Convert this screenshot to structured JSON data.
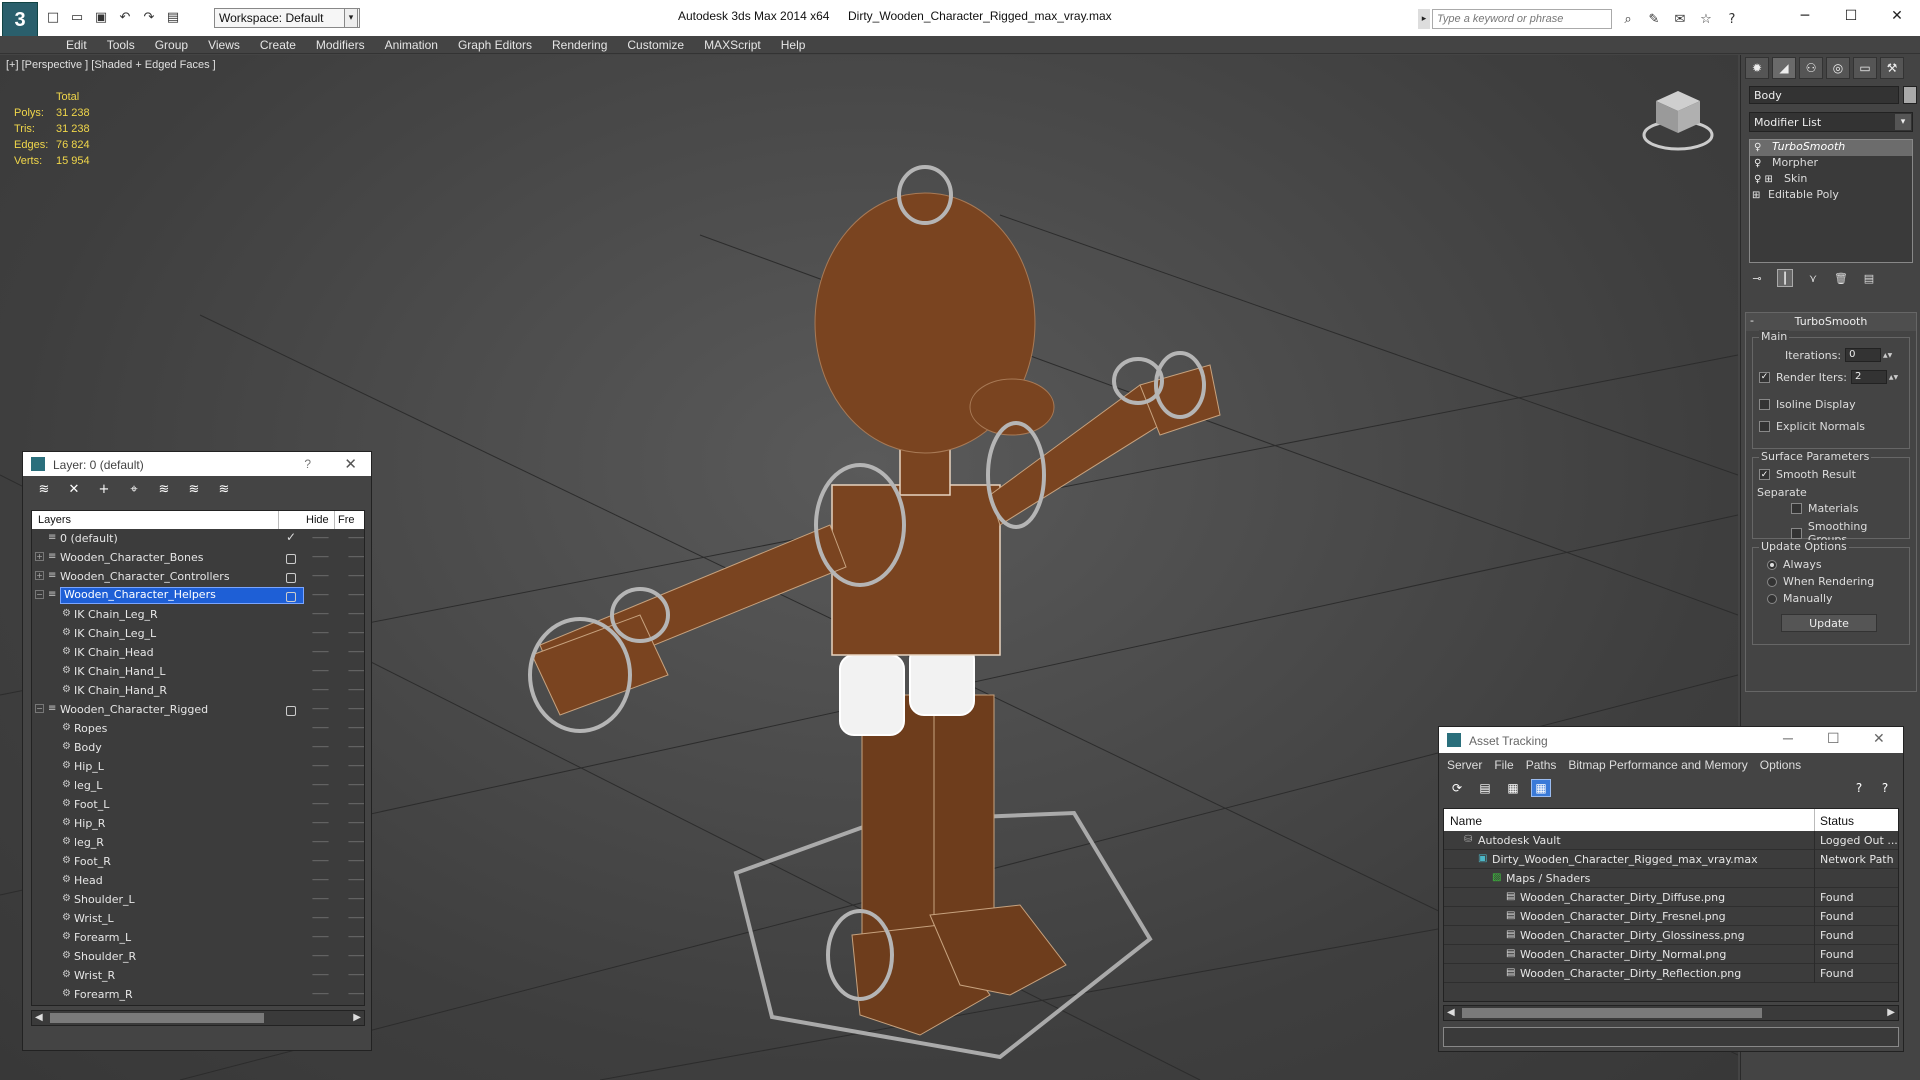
{
  "titlebar": {
    "workspace": "Workspace: Default",
    "app_title": "Autodesk 3ds Max  2014 x64",
    "file_title": "Dirty_Wooden_Character_Rigged_max_vray.max",
    "search_placeholder": "Type a keyword or phrase"
  },
  "menu": [
    "Edit",
    "Tools",
    "Group",
    "Views",
    "Create",
    "Modifiers",
    "Animation",
    "Graph Editors",
    "Rendering",
    "Customize",
    "MAXScript",
    "Help"
  ],
  "viewport": {
    "label": "[+] [Perspective ] [Shaded + Edged Faces ]",
    "stats_header": "Total",
    "stats": [
      {
        "label": "Polys:",
        "value": "31 238"
      },
      {
        "label": "Tris:",
        "value": "31 238"
      },
      {
        "label": "Edges:",
        "value": "76 824"
      },
      {
        "label": "Verts:",
        "value": "15 954"
      }
    ]
  },
  "cmdpanel": {
    "object_name": "Body",
    "modifier_list": "Modifier List",
    "stack": [
      "TurboSmooth",
      "Morpher",
      "Skin",
      "Editable Poly"
    ],
    "rollout_title": "TurboSmooth",
    "main_group": "Main",
    "iterations_label": "Iterations:",
    "iterations_value": "0",
    "render_iters_label": "Render Iters:",
    "render_iters_value": "2",
    "isoline": "Isoline Display",
    "explicit_normals": "Explicit Normals",
    "surface_group": "Surface Parameters",
    "smooth_result": "Smooth Result",
    "separate": "Separate",
    "materials": "Materials",
    "smoothing_groups": "Smoothing Groups",
    "update_group": "Update Options",
    "always": "Always",
    "when_rendering": "When Rendering",
    "manually": "Manually",
    "update_button": "Update"
  },
  "layerwin": {
    "title": "Layer: 0 (default)",
    "help": "?",
    "col_layers": "Layers",
    "col_hide": "Hide",
    "col_freeze": "Fre",
    "rows": [
      {
        "name": "0 (default)",
        "level": 0,
        "type": "layer",
        "active": true
      },
      {
        "name": "Wooden_Character_Bones",
        "level": 0,
        "type": "layer-exp"
      },
      {
        "name": "Wooden_Character_Controllers",
        "level": 0,
        "type": "layer-exp"
      },
      {
        "name": "Wooden_Character_Helpers",
        "level": 0,
        "type": "layer-open",
        "selected": true
      },
      {
        "name": "IK Chain_Leg_R",
        "level": 1,
        "type": "obj"
      },
      {
        "name": "IK Chain_Leg_L",
        "level": 1,
        "type": "obj"
      },
      {
        "name": "IK Chain_Head",
        "level": 1,
        "type": "obj"
      },
      {
        "name": "IK Chain_Hand_L",
        "level": 1,
        "type": "obj"
      },
      {
        "name": "IK Chain_Hand_R",
        "level": 1,
        "type": "obj"
      },
      {
        "name": "Wooden_Character_Rigged",
        "level": 0,
        "type": "layer-open"
      },
      {
        "name": "Ropes",
        "level": 1,
        "type": "obj"
      },
      {
        "name": "Body",
        "level": 1,
        "type": "obj"
      },
      {
        "name": "Hip_L",
        "level": 1,
        "type": "obj"
      },
      {
        "name": "leg_L",
        "level": 1,
        "type": "obj"
      },
      {
        "name": "Foot_L",
        "level": 1,
        "type": "obj"
      },
      {
        "name": "Hip_R",
        "level": 1,
        "type": "obj"
      },
      {
        "name": "leg_R",
        "level": 1,
        "type": "obj"
      },
      {
        "name": "Foot_R",
        "level": 1,
        "type": "obj"
      },
      {
        "name": "Head",
        "level": 1,
        "type": "obj"
      },
      {
        "name": "Shoulder_L",
        "level": 1,
        "type": "obj"
      },
      {
        "name": "Wrist_L",
        "level": 1,
        "type": "obj"
      },
      {
        "name": "Forearm_L",
        "level": 1,
        "type": "obj"
      },
      {
        "name": "Shoulder_R",
        "level": 1,
        "type": "obj"
      },
      {
        "name": "Wrist_R",
        "level": 1,
        "type": "obj"
      },
      {
        "name": "Forearm_R",
        "level": 1,
        "type": "obj"
      }
    ]
  },
  "assetwin": {
    "title": "Asset Tracking",
    "menu": [
      "Server",
      "File",
      "Paths",
      "Bitmap Performance and Memory",
      "Options"
    ],
    "col_name": "Name",
    "col_status": "Status",
    "rows": [
      {
        "name": "Autodesk Vault",
        "status": "Logged Out ...",
        "level": 0,
        "icon": "vault"
      },
      {
        "name": "Dirty_Wooden_Character_Rigged_max_vray.max",
        "status": "Network Path",
        "level": 1,
        "icon": "max"
      },
      {
        "name": "Maps / Shaders",
        "status": "",
        "level": 2,
        "icon": "maps"
      },
      {
        "name": "Wooden_Character_Dirty_Diffuse.png",
        "status": "Found",
        "level": 3,
        "icon": "file"
      },
      {
        "name": "Wooden_Character_Dirty_Fresnel.png",
        "status": "Found",
        "level": 3,
        "icon": "file"
      },
      {
        "name": "Wooden_Character_Dirty_Glossiness.png",
        "status": "Found",
        "level": 3,
        "icon": "file"
      },
      {
        "name": "Wooden_Character_Dirty_Normal.png",
        "status": "Found",
        "level": 3,
        "icon": "file"
      },
      {
        "name": "Wooden_Character_Dirty_Reflection.png",
        "status": "Found",
        "level": 3,
        "icon": "file"
      }
    ]
  },
  "colors": {
    "stats_yellow": "#f0d64a",
    "selection_blue": "#1e5fd6",
    "wood": "#7a4420"
  }
}
